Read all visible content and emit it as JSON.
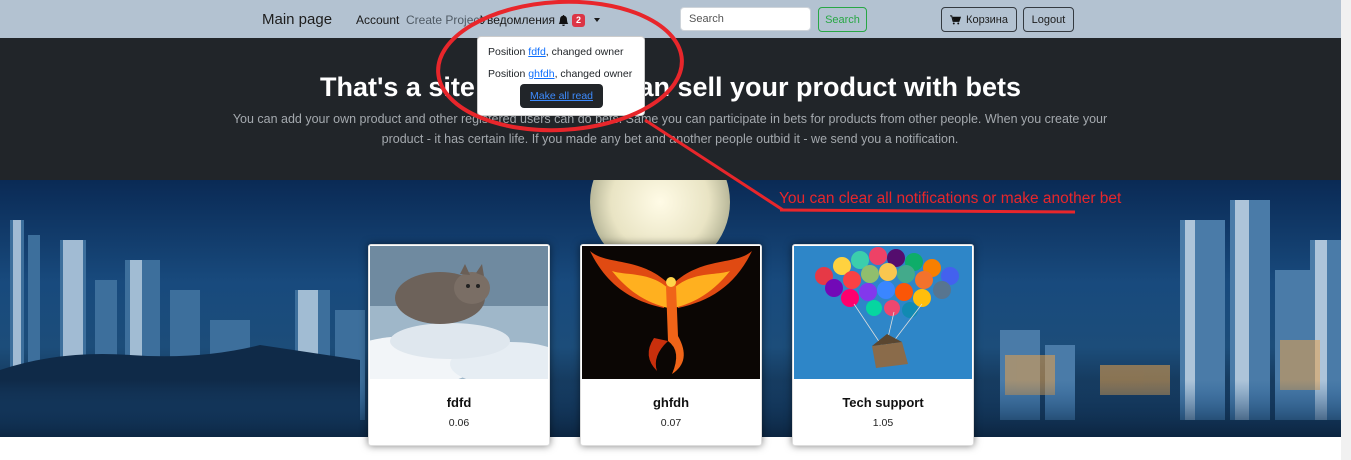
{
  "navbar": {
    "brand": "Main page",
    "account": "Account",
    "create_project": "Create Project",
    "notifications_label": "Уведомления",
    "notifications_count": "2",
    "search_placeholder": "Search",
    "search_button": "Search",
    "cart_button": "Корзина",
    "logout_button": "Logout"
  },
  "notifications": {
    "items": [
      {
        "prefix": "Position ",
        "link": "fdfd",
        "suffix": ", changed owner"
      },
      {
        "prefix": "Position ",
        "link": "ghfdh",
        "suffix": ", changed owner"
      }
    ],
    "mark_read": "Make all read"
  },
  "hero": {
    "title": "That's a site where you can sell your product with bets",
    "text": "You can add your own product and other registered users can do bets. Same you can participate in bets for products from other people. When you create your product - it has certain life. If you made any bet and another people outbid it - we send you a notification."
  },
  "annotation": "You can clear all notifications or make another bet",
  "products": [
    {
      "title": "fdfd",
      "price": "0.06"
    },
    {
      "title": "ghfdh",
      "price": "0.07"
    },
    {
      "title": "Tech support",
      "price": "1.05"
    }
  ],
  "colors": {
    "navbar": "#b3c2d1",
    "hero": "#212529",
    "badge": "#dc3545",
    "success": "#28a745",
    "annotation": "#e8262b"
  }
}
